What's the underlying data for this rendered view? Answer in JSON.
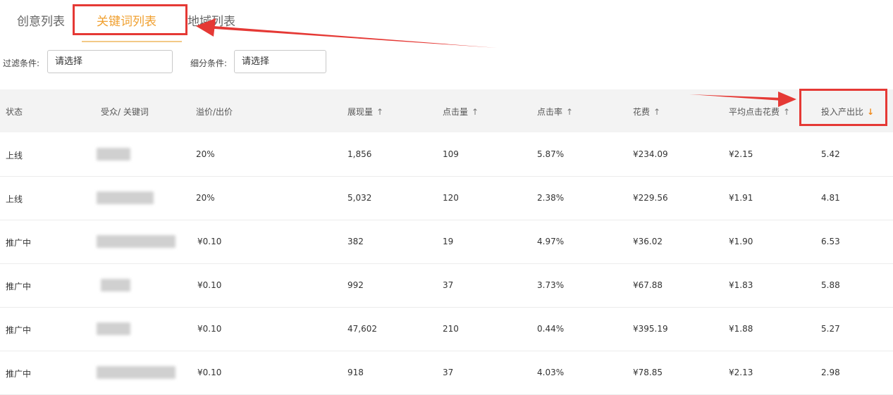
{
  "tabs": [
    {
      "label": "创意列表",
      "active": false
    },
    {
      "label": "关键词列表",
      "active": true
    },
    {
      "label": "地域列表",
      "active": false
    }
  ],
  "filters": {
    "filter_label": "过滤条件:",
    "filter_value": "请选择",
    "detail_label": "细分条件:",
    "detail_value": "请选择"
  },
  "table": {
    "headers": [
      {
        "label": "状态",
        "sort": ""
      },
      {
        "label": "受众/ 关键词",
        "sort": ""
      },
      {
        "label": "溢价/出价",
        "sort": ""
      },
      {
        "label": "展现量",
        "sort": "↑"
      },
      {
        "label": "点击量",
        "sort": "↑"
      },
      {
        "label": "点击率",
        "sort": "↑"
      },
      {
        "label": "花费",
        "sort": "↑"
      },
      {
        "label": "平均点击花费",
        "sort": "↑"
      },
      {
        "label": "投入产出比",
        "sort": "↓"
      }
    ],
    "rows": [
      {
        "status": "上线",
        "bid": "20%",
        "impressions": "1,856",
        "clicks": "109",
        "ctr": "5.87%",
        "cost": "¥234.09",
        "cpc": "¥2.15",
        "roi": "5.42"
      },
      {
        "status": "上线",
        "bid": "20%",
        "impressions": "5,032",
        "clicks": "120",
        "ctr": "2.38%",
        "cost": "¥229.56",
        "cpc": "¥1.91",
        "roi": "4.81"
      },
      {
        "status": "推广中",
        "bid": "¥0.10",
        "impressions": "382",
        "clicks": "19",
        "ctr": "4.97%",
        "cost": "¥36.02",
        "cpc": "¥1.90",
        "roi": "6.53"
      },
      {
        "status": "推广中",
        "bid": "¥0.10",
        "impressions": "992",
        "clicks": "37",
        "ctr": "3.73%",
        "cost": "¥67.88",
        "cpc": "¥1.83",
        "roi": "5.88"
      },
      {
        "status": "推广中",
        "bid": "¥0.10",
        "impressions": "47,602",
        "clicks": "210",
        "ctr": "0.44%",
        "cost": "¥395.19",
        "cpc": "¥1.88",
        "roi": "5.27"
      },
      {
        "status": "推广中",
        "bid": "¥0.10",
        "impressions": "918",
        "clicks": "37",
        "ctr": "4.03%",
        "cost": "¥78.85",
        "cpc": "¥2.13",
        "roi": "2.98"
      }
    ]
  },
  "colors": {
    "accent": "#f0a030",
    "annotation": "#e53935",
    "header_bg": "#f3f3f3"
  }
}
